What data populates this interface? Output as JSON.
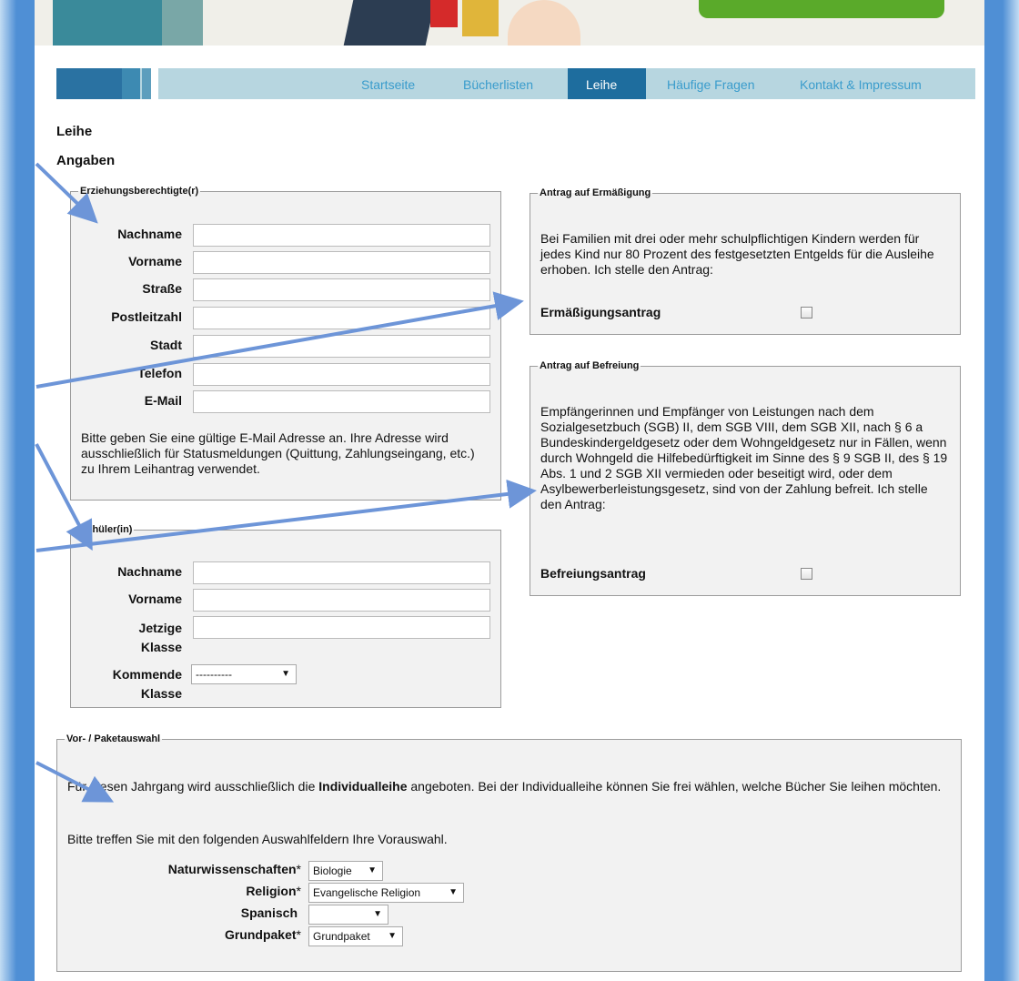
{
  "nav": {
    "items": [
      "Startseite",
      "Bücherlisten",
      "Leihe",
      "Häufige Fragen",
      "Kontakt & Impressum"
    ],
    "active": "Leihe"
  },
  "page": {
    "title": "Leihe",
    "section": "Angaben"
  },
  "parent": {
    "legend": "Erziehungsberechtigte(r)",
    "fields": [
      "Nachname",
      "Vorname",
      "Straße",
      "Postleitzahl",
      "Stadt",
      "Telefon",
      "E-Mail"
    ],
    "note": "Bitte geben Sie eine gültige E-Mail Adresse an. Ihre Adresse wird ausschließlich für Statusmeldungen (Quittung, Zahlungseingang, etc.) zu Ihrem Leihantrag verwendet."
  },
  "student": {
    "legend": "Schüler(in)",
    "fields": [
      "Nachname",
      "Vorname",
      "Jetzige Klasse"
    ],
    "next_class_label": "Kommende Klasse",
    "next_class_value": "----------"
  },
  "reduction": {
    "legend": "Antrag auf Ermäßigung",
    "text": "Bei Familien mit drei oder mehr schulpflichtigen Kindern werden für jedes Kind nur 80 Prozent des festgesetzten Entgelds für die Ausleihe erhoben. Ich stelle den Antrag:",
    "checkbox_label": "Ermäßigungsantrag"
  },
  "exemption": {
    "legend": "Antrag auf Befreiung",
    "text": "Empfängerinnen und Empfänger von Leistungen nach dem Sozialgesetzbuch (SGB) II, dem SGB VIII, dem SGB XII, nach § 6 a Bundeskindergeldgesetz oder dem Wohngeldgesetz nur in Fällen, wenn durch Wohngeld die Hilfebedürftigkeit im Sinne des § 9 SGB II, des § 19 Abs. 1 und 2 SGB XII vermieden oder beseitigt wird, oder dem Asylbewerberleistungsgesetz, sind von der Zahlung befreit. Ich stelle den Antrag:",
    "checkbox_label": "Befreiungsantrag"
  },
  "package": {
    "legend": "Vor- / Paketauswahl",
    "intro_pre": "Für diesen Jahrgang wird ausschließlich die ",
    "intro_bold": "Individualleihe",
    "intro_post": " angeboten. Bei der Individualleihe können Sie frei wählen, welche Bücher Sie leihen möchten.",
    "hint": "Bitte treffen Sie mit den folgenden Auswahlfeldern Ihre Vorauswahl.",
    "selects": [
      {
        "label": "Naturwissenschaften",
        "required": "*",
        "value": "Biologie"
      },
      {
        "label": "Religion",
        "required": "*",
        "value": "Evangelische Religion"
      },
      {
        "label": "Spanisch",
        "required": "",
        "value": ""
      },
      {
        "label": "Grundpaket",
        "required": "*",
        "value": "Grundpaket"
      }
    ]
  },
  "colors": {
    "nav_active": "#1e6d9e",
    "nav_link": "#3a9ccc",
    "annotation_arrow": "#6d95d8"
  }
}
